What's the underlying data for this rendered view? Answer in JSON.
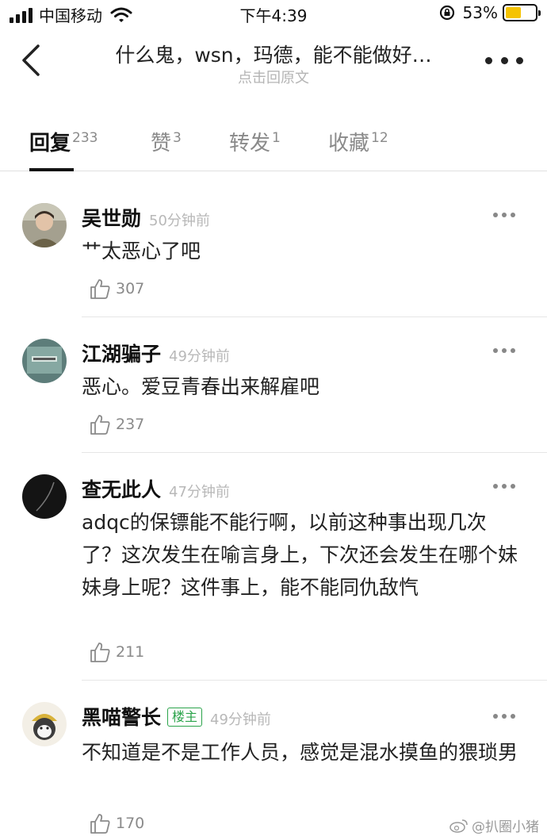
{
  "status_bar": {
    "carrier": "中国移动",
    "time": "下午4:39",
    "battery": "53%",
    "battery_level": 0.53
  },
  "header": {
    "title": "什么鬼，wsn，玛德，能不能做好…",
    "subtitle": "点击回原文"
  },
  "tabs": [
    {
      "label": "回复",
      "count": "233"
    },
    {
      "label": "赞",
      "count": "3"
    },
    {
      "label": "转发",
      "count": "1"
    },
    {
      "label": "收藏",
      "count": "12"
    }
  ],
  "comments": [
    {
      "name": "吴世勋",
      "time": "50分钟前",
      "text": "艹太恶心了吧",
      "likes": "307"
    },
    {
      "name": "江湖骗子",
      "time": "49分钟前",
      "text": "恶心。爱豆青春出来解雇吧",
      "likes": "237"
    },
    {
      "name": "查无此人",
      "time": "47分钟前",
      "text": "adqc的保镖能不能行啊，以前这种事出现几次了？这次发生在喻言身上，下次还会发生在哪个妹妹身上呢？这件事上，能不能同仇敌忾",
      "likes": "211"
    },
    {
      "name": "黑喵警长",
      "badge": "楼主",
      "time": "49分钟前",
      "text": "不知道是不是工作人员，感觉是混水摸鱼的猥琐男",
      "likes": "170"
    }
  ],
  "watermark": "@扒圈小猪"
}
